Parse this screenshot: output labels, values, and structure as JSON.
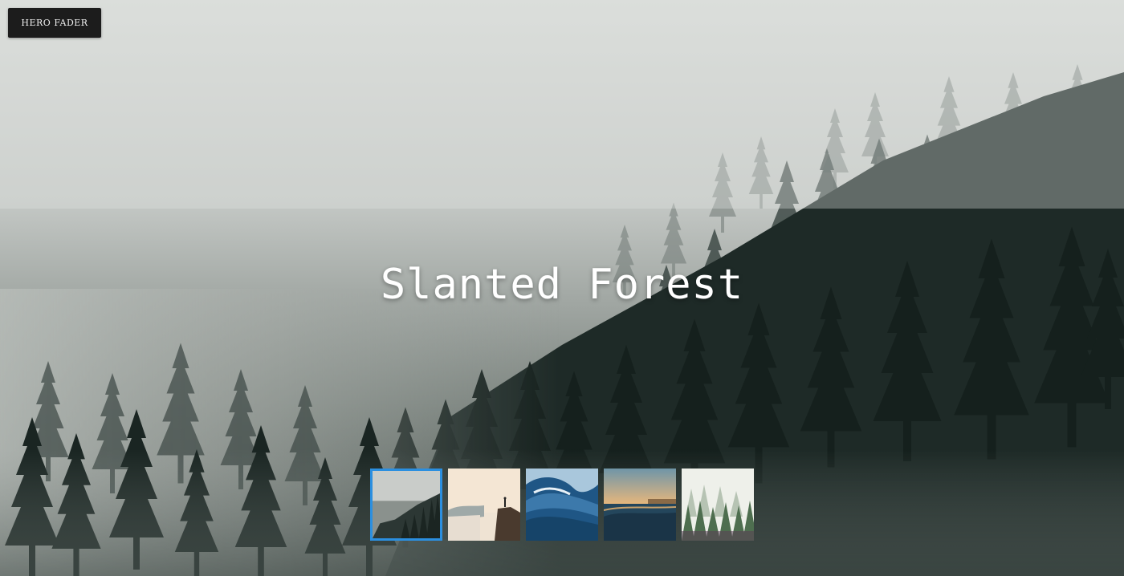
{
  "header": {
    "button_label": "HERO FADER"
  },
  "hero": {
    "title": "Slanted Forest"
  },
  "thumbnails": {
    "active_index": 0,
    "accent_color": "#2b8fe0",
    "items": [
      {
        "scene": "foggy-forest-thumbnail"
      },
      {
        "scene": "cliff-waterfall-thumbnail"
      },
      {
        "scene": "ocean-wave-thumbnail"
      },
      {
        "scene": "sunset-sea-thumbnail"
      },
      {
        "scene": "misty-pines-thumbnail"
      }
    ]
  }
}
